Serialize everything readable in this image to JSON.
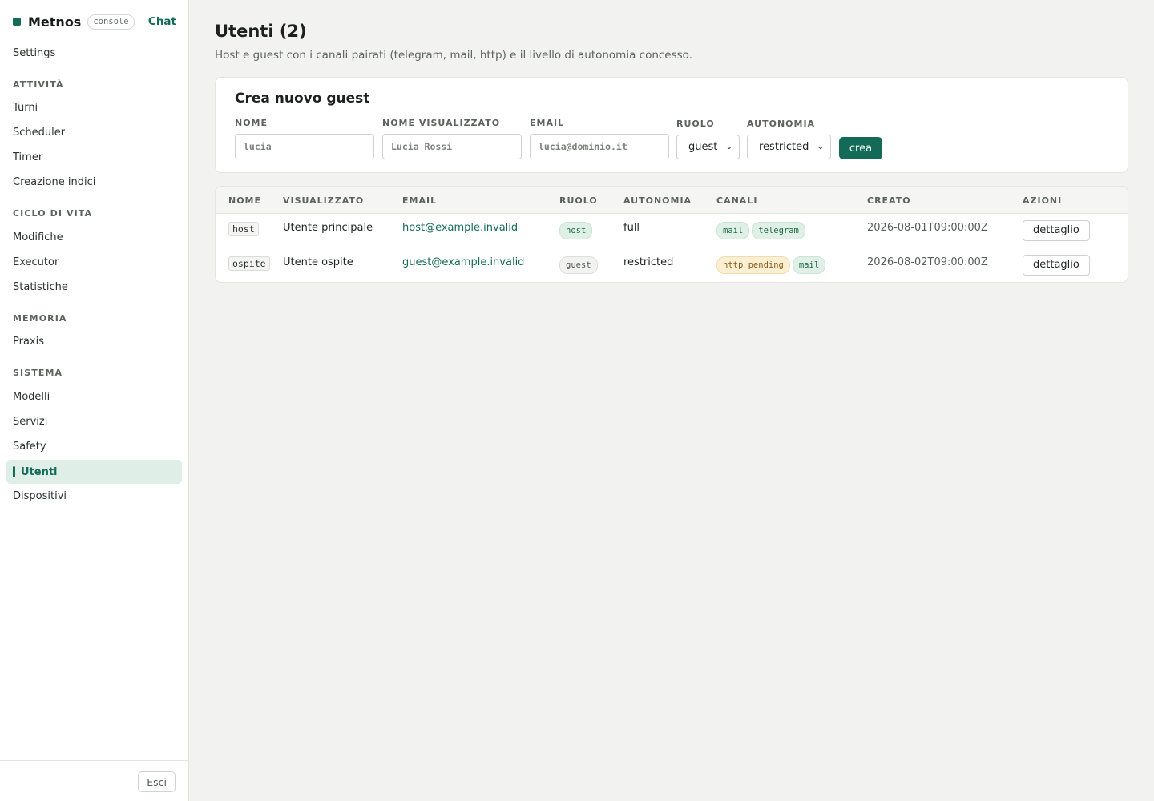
{
  "sidebar": {
    "brand": "Metnos",
    "badge": "console",
    "chat_link": "Chat",
    "top_items": [
      {
        "label": "Settings"
      }
    ],
    "sections": [
      {
        "title": "ATTIVITÀ",
        "items": [
          {
            "label": "Turni"
          },
          {
            "label": "Scheduler"
          },
          {
            "label": "Timer"
          },
          {
            "label": "Creazione indici"
          }
        ]
      },
      {
        "title": "CICLO DI VITA",
        "items": [
          {
            "label": "Modifiche"
          },
          {
            "label": "Executor"
          },
          {
            "label": "Statistiche"
          }
        ]
      },
      {
        "title": "MEMORIA",
        "items": [
          {
            "label": "Praxis"
          }
        ]
      },
      {
        "title": "SISTEMA",
        "items": [
          {
            "label": "Modelli"
          },
          {
            "label": "Servizi"
          },
          {
            "label": "Safety"
          },
          {
            "label": "Utenti",
            "active": true
          },
          {
            "label": "Dispositivi"
          }
        ]
      }
    ],
    "logout": "Esci"
  },
  "page": {
    "title": "Utenti (2)",
    "subtitle": "Host e guest con i canali pairati (telegram, mail, http) e il livello di autonomia concesso."
  },
  "create_form": {
    "title": "Crea nuovo guest",
    "fields": {
      "nome": {
        "label": "NOME",
        "placeholder": "lucia",
        "value": ""
      },
      "nome_visualizzato": {
        "label": "NOME VISUALIZZATO",
        "placeholder": "Lucia Rossi",
        "value": ""
      },
      "email": {
        "label": "EMAIL",
        "placeholder": "lucia@dominio.it",
        "value": ""
      },
      "ruolo": {
        "label": "RUOLO",
        "value": "guest"
      },
      "autonomia": {
        "label": "AUTONOMIA",
        "value": "restricted"
      }
    },
    "submit_label": "crea"
  },
  "table": {
    "columns": [
      "NOME",
      "VISUALIZZATO",
      "EMAIL",
      "RUOLO",
      "AUTONOMIA",
      "CANALI",
      "CREATO",
      "AZIONI"
    ],
    "rows": [
      {
        "nome": "host",
        "visualizzato": "Utente principale",
        "email": "host@example.invalid",
        "ruolo": "host",
        "autonomia": "full",
        "canali": [
          {
            "label": "mail",
            "status": "green"
          },
          {
            "label": "telegram",
            "status": "green"
          }
        ],
        "creato": "2026-08-01T09:00:00Z",
        "azione": "dettaglio"
      },
      {
        "nome": "ospite",
        "visualizzato": "Utente ospite",
        "email": "guest@example.invalid",
        "ruolo": "guest",
        "autonomia": "restricted",
        "canali": [
          {
            "label": "http pending",
            "status": "amber"
          },
          {
            "label": "mail",
            "status": "green"
          }
        ],
        "creato": "2026-08-02T09:00:00Z",
        "azione": "dettaglio"
      }
    ]
  },
  "colors": {
    "accent": "#136b57",
    "active_bg": "#e0eee8",
    "pending": "#fbefd3"
  }
}
